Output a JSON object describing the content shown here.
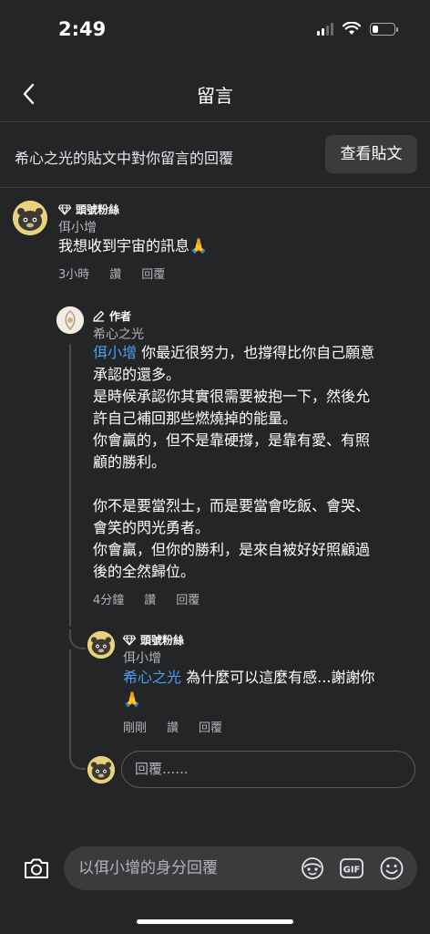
{
  "status": {
    "time": "2:49",
    "battery_level": 0.25
  },
  "header": {
    "title": "留言"
  },
  "context": {
    "text": "希心之光的貼文中對你留言的回覆",
    "view_post_label": "查看貼文"
  },
  "comments": {
    "first": {
      "badge": "頭號粉絲",
      "name": "佴小增",
      "text": "我想收到宇宙的訊息🙏",
      "time": "3小時",
      "like": "讚",
      "reply": "回覆"
    },
    "second": {
      "badge": "作者",
      "name": "希心之光",
      "mention": "佴小增",
      "text_line1": " 你最近很努力，也撐得比你自己願意",
      "text_line2": "承認的還多。",
      "text_line3": "是時候承認你其實很需要被抱一下，然後允",
      "text_line4": "許自己補回那些燃燒掉的能量。",
      "text_line5": "你會贏的，但不是靠硬撐，是靠有愛、有照",
      "text_line6": "顧的勝利。",
      "text_line7": "你不是要當烈士，而是要當會吃飯、會哭、",
      "text_line8": "會笑的閃光勇者。",
      "text_line9": "你會贏，但你的勝利，是來自被好好照顧過",
      "text_line10": "後的全然歸位。",
      "time": "4分鐘",
      "like": "讚",
      "reply": "回覆"
    },
    "third": {
      "badge": "頭號粉絲",
      "name": "佴小增",
      "mention": "希心之光",
      "text_line1": " 為什麼可以這麼有感...謝謝你",
      "text_line2": "🙏",
      "time": "剛剛",
      "like": "讚",
      "reply": "回覆"
    }
  },
  "reply_box": {
    "placeholder": "回覆......"
  },
  "composer": {
    "placeholder": "以佴小增的身分回覆",
    "gif_label": "GIF"
  }
}
